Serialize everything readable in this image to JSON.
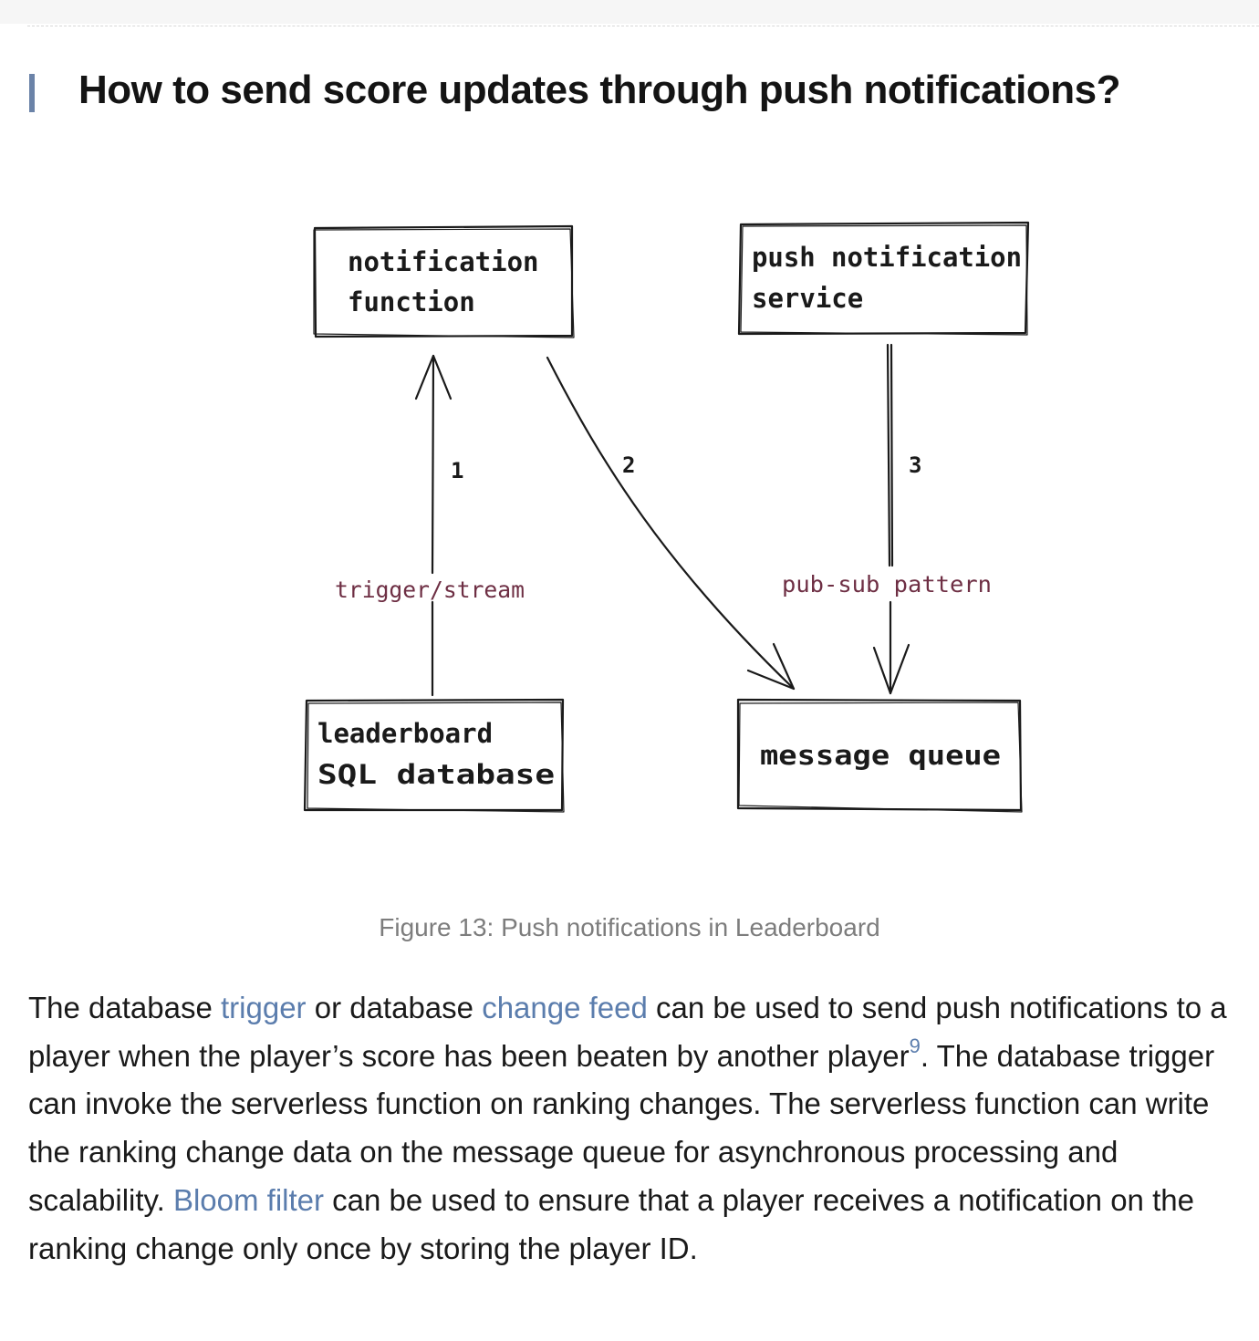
{
  "heading": "How to send score updates through push notifications?",
  "diagram": {
    "boxes": {
      "notification_function": [
        "notification",
        "function"
      ],
      "push_service": [
        "push notification",
        "service"
      ],
      "leaderboard_db": [
        "leaderboard",
        "SQL database"
      ],
      "message_queue": "message queue"
    },
    "edges": {
      "e1": "1",
      "e2": "2",
      "e3": "3"
    },
    "annotations": {
      "trigger": "trigger/stream",
      "pubsub": "pub-sub pattern"
    }
  },
  "caption": "Figure 13: Push notifications in Leaderboard",
  "paragraph": {
    "p1": "The database ",
    "link_trigger": "trigger",
    "p2": " or database ",
    "link_change_feed": "change feed",
    "p3": " can be used to send push notifications to a player when the player’s score has been beaten by another player",
    "footnote": "9",
    "p4": ". The database trigger can invoke the serverless function on ranking changes. The serverless function can write the ranking change data on the message queue for asynchronous processing and scalability. ",
    "link_bloom": "Bloom filter",
    "p5": " can be used to ensure that a player receives a notification on the ranking change only once by storing the player ID."
  },
  "colors": {
    "accent_bar": "#6b83a8",
    "link": "#5b7dad",
    "annotation": "#6e2f44",
    "caption": "#7d7d7d"
  }
}
